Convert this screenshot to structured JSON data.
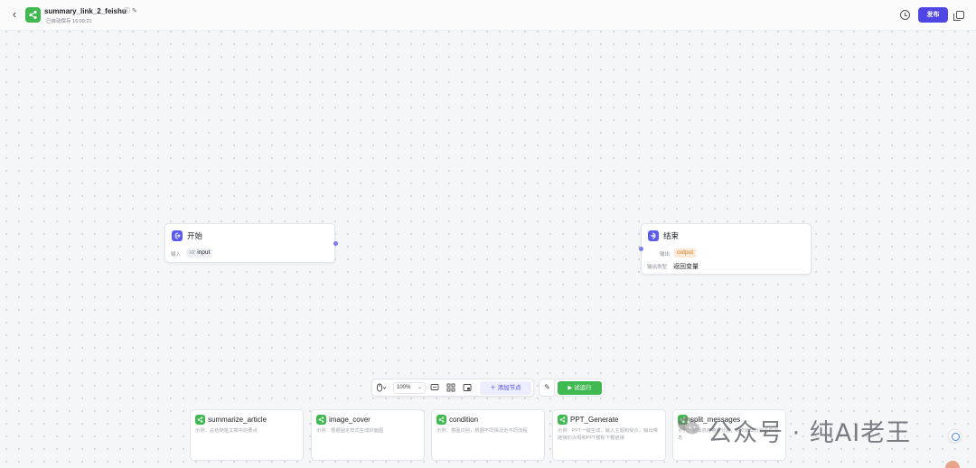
{
  "header": {
    "title": "summary_link_2_feishu",
    "save_status": "已自动保存 16:09:21",
    "publish_label": "发布",
    "icons": [
      "back-icon",
      "app-logo-icon",
      "info-icon",
      "edit-icon",
      "history-icon",
      "copy-icon"
    ]
  },
  "canvas": {
    "start_node": {
      "title": "开始",
      "input_label": "输入",
      "input_type": "str",
      "input_name": "input"
    },
    "end_node": {
      "title": "结束",
      "output_label": "输出",
      "output_value": "output",
      "output_type_label": "输出类型",
      "output_type_value": "返回变量"
    }
  },
  "toolbar": {
    "zoom": "100%",
    "add_node_label": "添加节点",
    "run_label": "试运行"
  },
  "templates": [
    {
      "title": "summarize_article",
      "desc": "示例：总结随笔文章中的要点"
    },
    {
      "title": "image_cover",
      "desc": "示例：根据固定样式生成封面图"
    },
    {
      "title": "condition",
      "desc": "示例：意图识别，根据不同情况走不同流程"
    },
    {
      "title": "PPT_Generate",
      "desc": "示例：PPT一键生成，输入主题和受众，输出带链接的大纲和PPT模板下载链接"
    },
    {
      "title": "split_messages",
      "desc": "示例：将消息按换行分割，依次输出分割后的消息"
    }
  ],
  "watermark": "公众号 · 纯AI老王",
  "colors": {
    "accent": "#4f46e5",
    "node_icon": "#5b5bf0",
    "template_icon": "#3fb950",
    "run_button": "#3fb950",
    "output_tag": "#d97b2c"
  }
}
